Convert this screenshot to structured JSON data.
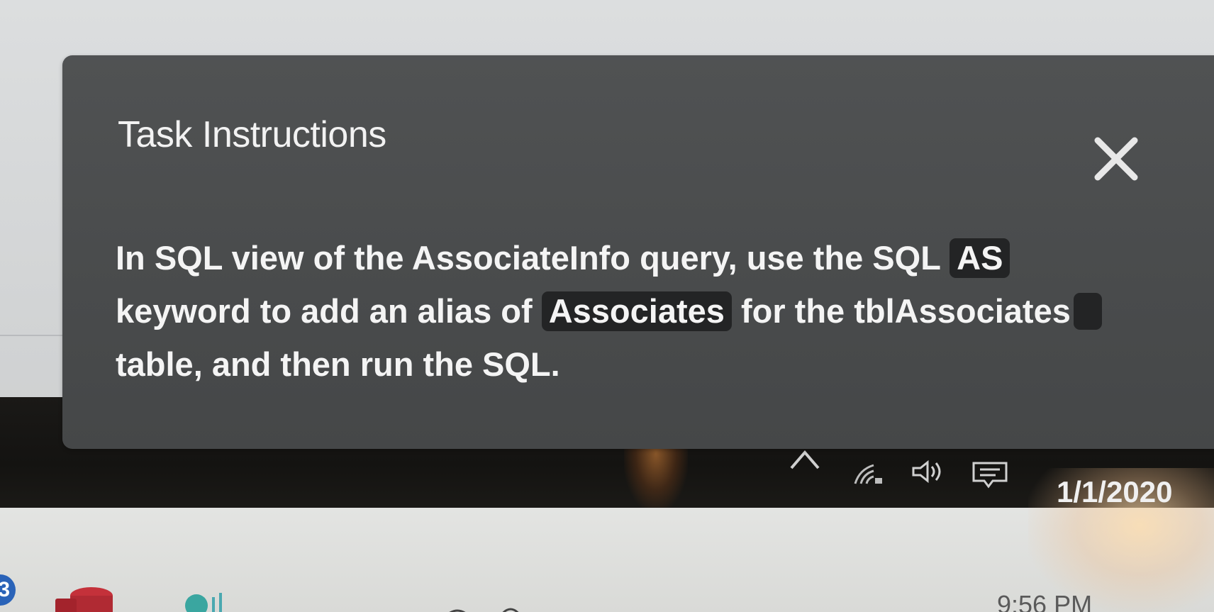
{
  "task_panel": {
    "title": "Task Instructions",
    "text_before_as": "In SQL view of the AssociateInfo query, use the SQL ",
    "keyword_as": "AS",
    "text_before_alias": " keyword to add an alias of ",
    "keyword_alias": "Associates",
    "text_before_table": " for the tblAssociates",
    "text_after_table": " table, and then run the SQL.",
    "close_icon": "close-icon"
  },
  "taskbar": {
    "tray_icons": [
      "chevron-up-icon",
      "network-icon",
      "volume-icon",
      "notification-icon"
    ],
    "date": "1/1/2020",
    "time": "9:56 PM",
    "badge": "3",
    "apps": [
      "access-app-icon",
      "teal-app-icon"
    ]
  },
  "colors": {
    "panel_bg": "#4a4c4d",
    "keyword_bg": "#232425",
    "text": "#f4f4f4",
    "taskbar_bg": "#151412",
    "access_red": "#c4313a"
  }
}
